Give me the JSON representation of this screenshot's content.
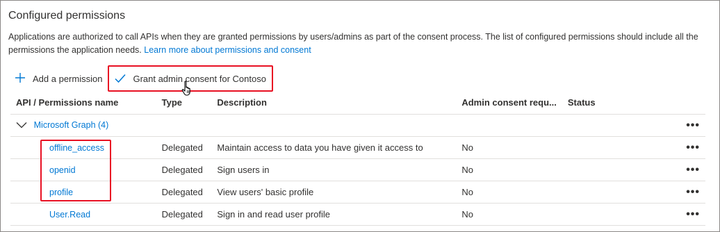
{
  "section": {
    "title": "Configured permissions",
    "description": "Applications are authorized to call APIs when they are granted permissions by users/admins as part of the consent process. The list of configured permissions should include all the permissions the application needs.",
    "learn_more_link": "Learn more about permissions and consent"
  },
  "toolbar": {
    "add_permission_label": "Add a permission",
    "grant_consent_label": "Grant admin consent for Contoso"
  },
  "table": {
    "columns": [
      "API / Permissions name",
      "Type",
      "Description",
      "Admin consent requ...",
      "Status"
    ],
    "group": {
      "label": "Microsoft Graph (4)",
      "more": "•••"
    },
    "rows": [
      {
        "name": "offline_access",
        "type": "Delegated",
        "description": "Maintain access to data you have given it access to",
        "admin_consent": "No",
        "status": "",
        "more": "•••"
      },
      {
        "name": "openid",
        "type": "Delegated",
        "description": "Sign users in",
        "admin_consent": "No",
        "status": "",
        "more": "•••"
      },
      {
        "name": "profile",
        "type": "Delegated",
        "description": "View users' basic profile",
        "admin_consent": "No",
        "status": "",
        "more": "•••"
      },
      {
        "name": "User.Read",
        "type": "Delegated",
        "description": "Sign in and read user profile",
        "admin_consent": "No",
        "status": "",
        "more": "•••"
      }
    ]
  },
  "colors": {
    "link": "#0078d4",
    "highlight": "#e81123",
    "text": "#323130",
    "divider": "#e1dfdd"
  },
  "icons": {
    "add": "plus-icon",
    "grant": "checkmark-icon",
    "expand": "chevron-down-icon",
    "more": "more-icon",
    "cursor": "hand-pointer-icon"
  }
}
